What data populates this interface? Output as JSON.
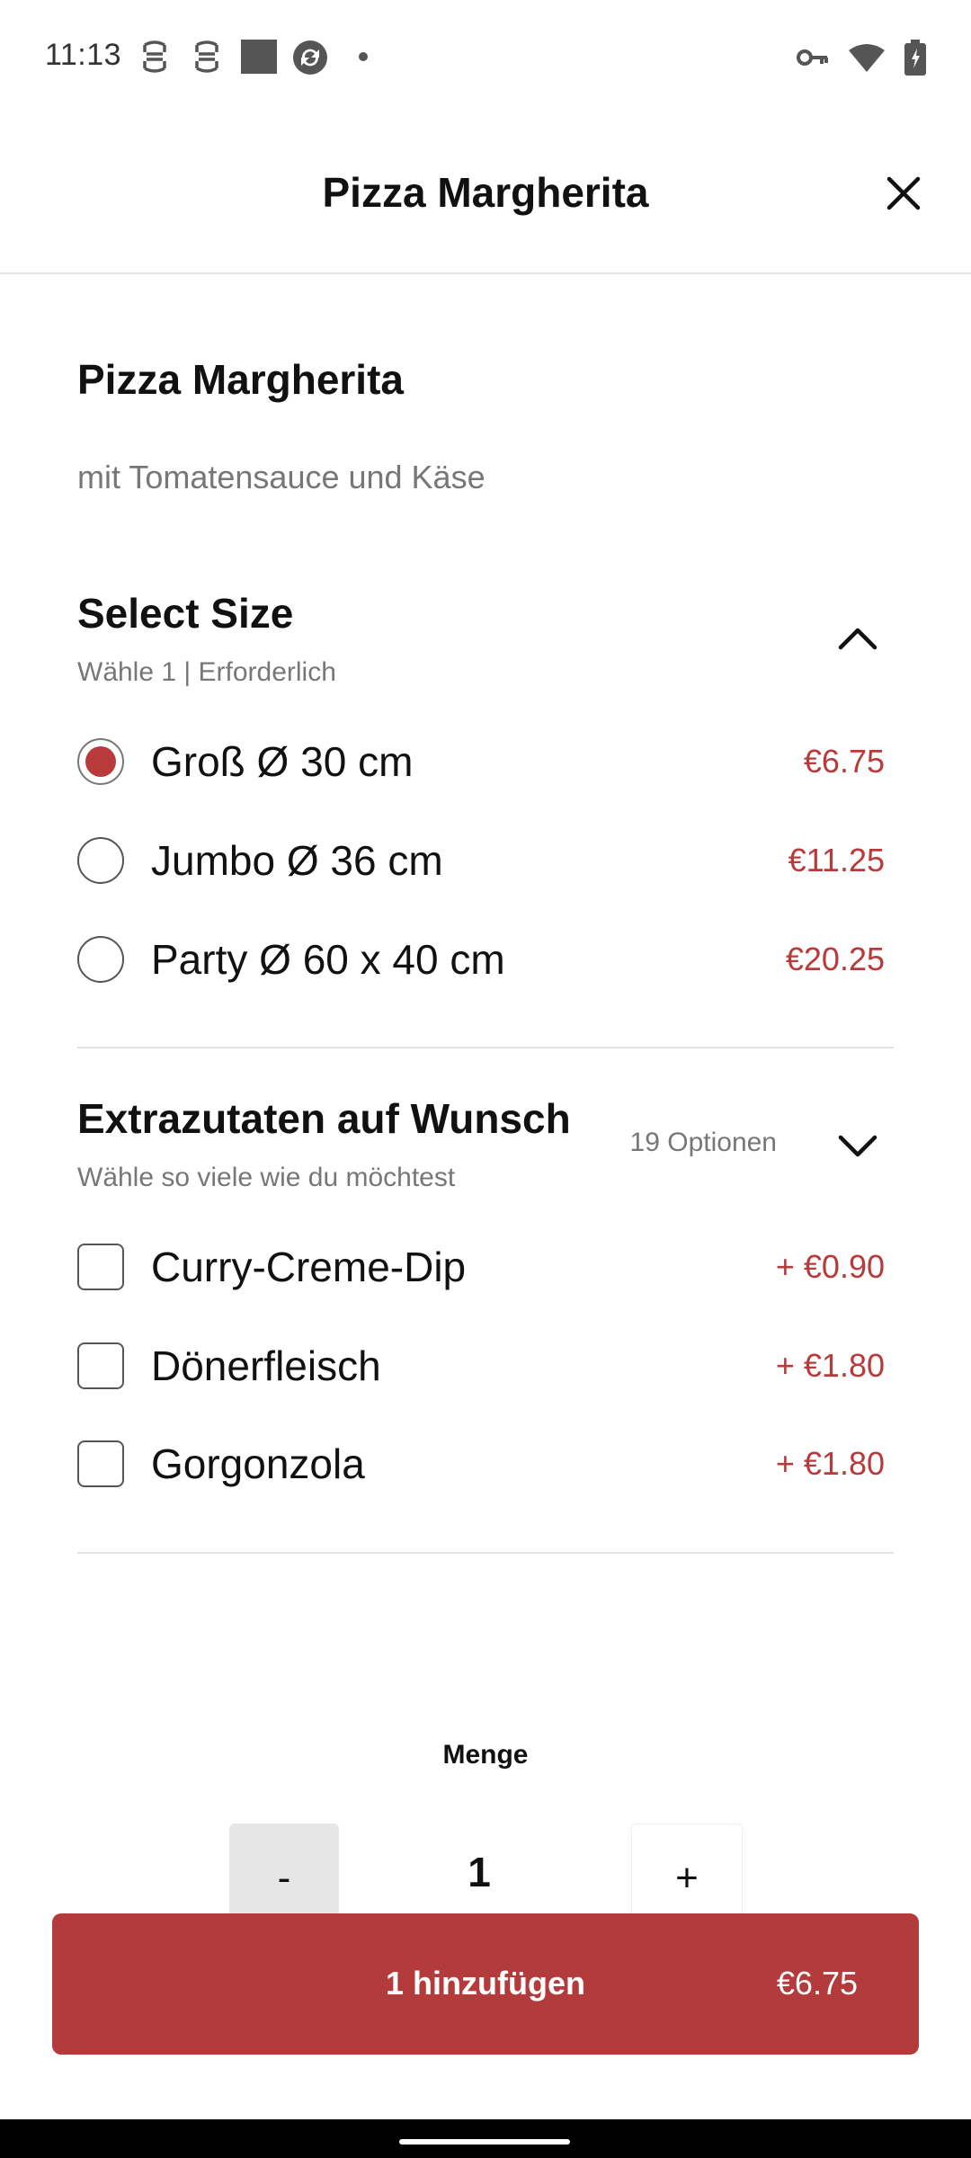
{
  "status_bar": {
    "time": "11:13",
    "left_icons": [
      "notification-icon",
      "notification-icon",
      "app-icon",
      "sync-icon",
      "dot-icon"
    ],
    "right_icons": [
      "vpn-key-icon",
      "wifi-icon",
      "battery-icon"
    ]
  },
  "header": {
    "title": "Pizza Margherita",
    "close_icon": "close-icon"
  },
  "product": {
    "name": "Pizza Margherita",
    "description": "mit Tomatensauce und Käse"
  },
  "size_section": {
    "title": "Select Size",
    "subtitle": "Wähle 1  |  Erforderlich",
    "expanded": true,
    "options": [
      {
        "label": "Groß Ø 30 cm",
        "price": "€6.75",
        "selected": true
      },
      {
        "label": "Jumbo Ø 36 cm",
        "price": "€11.25",
        "selected": false
      },
      {
        "label": "Party Ø 60 x 40 cm",
        "price": "€20.25",
        "selected": false
      }
    ]
  },
  "extras_section": {
    "title": "Extrazutaten auf Wunsch",
    "subtitle": "Wähle so viele wie du möchtest",
    "count": "19 Optionen",
    "expanded": false,
    "options": [
      {
        "label": "Curry-Creme-Dip",
        "price": "+ €0.90",
        "checked": false
      },
      {
        "label": "Dönerfleisch",
        "price": "+ €1.80",
        "checked": false
      },
      {
        "label": "Gorgonzola",
        "price": "+ €1.80",
        "checked": false
      }
    ]
  },
  "quantity": {
    "label": "Menge",
    "minus": "-",
    "value": "1",
    "plus": "+"
  },
  "add_button": {
    "label": "1 hinzufügen",
    "price": "€6.75"
  },
  "colors": {
    "accent": "#b33b3b",
    "muted_text": "#777777",
    "divider": "#e2e2e2"
  }
}
